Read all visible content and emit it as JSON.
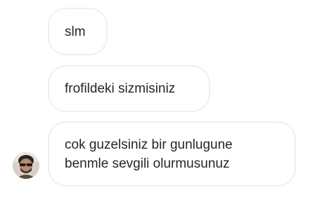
{
  "messages": [
    {
      "text": "slm"
    },
    {
      "text": "frofildeki sizmisiniz"
    },
    {
      "text": "cok guzelsiniz bir gunlugune\nbenmle sevgili olurmusunuz"
    }
  ],
  "colors": {
    "background": "#ffffff",
    "bubble_border": "#efefef",
    "text": "#262626"
  },
  "sender": {
    "avatar_icon": "profile-photo"
  }
}
